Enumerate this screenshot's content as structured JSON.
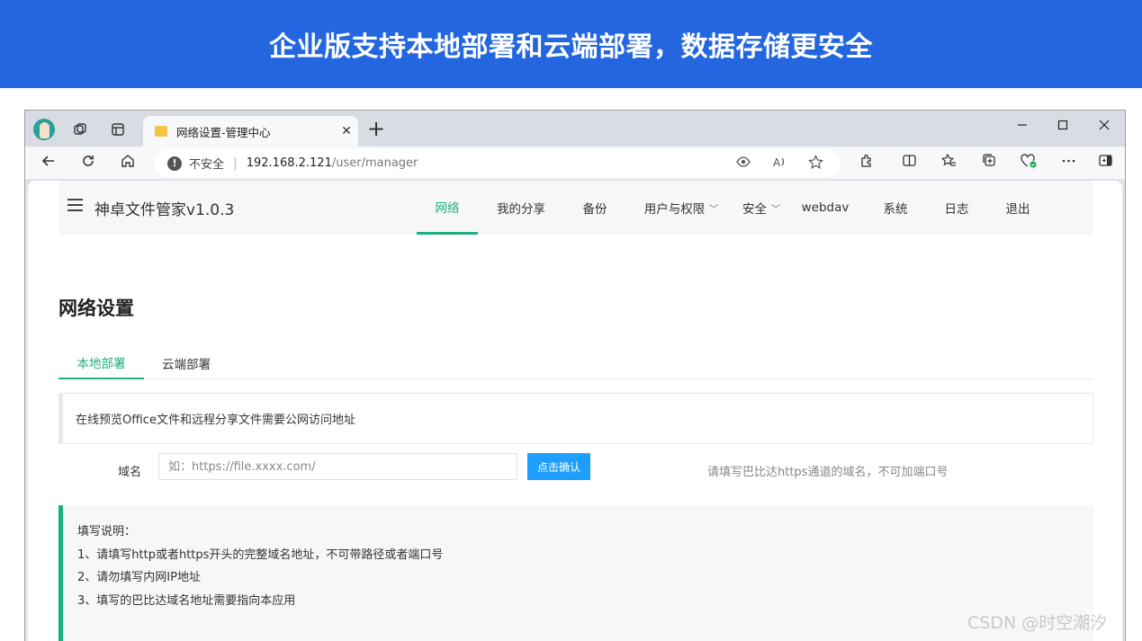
{
  "banner": {
    "title": "企业版支持本地部署和云端部署，数据存储更安全"
  },
  "browser": {
    "tab_title": "网络设置-管理中心",
    "close_glyph": "✕",
    "new_tab_glyph": "+",
    "insecure_label": "不安全",
    "url_host": "192.168.2.121",
    "url_path": "/user/manager",
    "icons": [
      "back-icon",
      "refresh-icon",
      "home-icon",
      "eye-icon",
      "read-aloud-icon",
      "favorite-icon",
      "extensions-icon",
      "split-screen-icon",
      "favorites-icon",
      "collections-icon",
      "browser-essentials-icon",
      "more-icon",
      "sidebar-icon"
    ]
  },
  "app": {
    "title": "神卓文件管家v1.0.3",
    "nav": [
      {
        "label": "网络",
        "active": true
      },
      {
        "label": "我的分享"
      },
      {
        "label": "备份"
      },
      {
        "label": "用户与权限",
        "dropdown": true
      },
      {
        "label": "安全",
        "dropdown": true
      },
      {
        "label": "webdav"
      },
      {
        "label": "系统"
      },
      {
        "label": "日志"
      },
      {
        "label": "退出"
      }
    ]
  },
  "page": {
    "heading": "网络设置",
    "tabs": [
      {
        "label": "本地部署",
        "active": true
      },
      {
        "label": "云端部署"
      }
    ],
    "notice": "在线预览Office文件和远程分享文件需要公网访问地址",
    "domain_label": "域名",
    "domain_placeholder": "如：https://file.xxxx.com/",
    "confirm_button": "点击确认",
    "hint": "请填写巴比达https通道的域名，不可加端口号",
    "help": {
      "title": "填写说明：",
      "items": [
        "1、请填写http或者https开头的完整域名地址，不可带路径或者端口号",
        "2、请勿填写内网IP地址",
        "3、填写的巴比达域名地址需要指向本应用"
      ]
    }
  },
  "colors": {
    "banner": "#2366e0",
    "accent": "#1bb07c",
    "button": "#1e9fff"
  },
  "watermark": "CSDN @时空潮汐"
}
